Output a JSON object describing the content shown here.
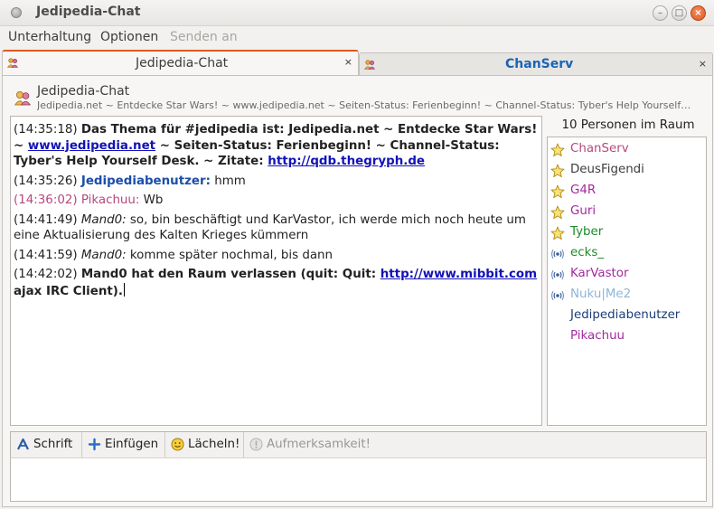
{
  "window": {
    "title": "Jedipedia-Chat"
  },
  "menu": {
    "items": [
      "Unterhaltung",
      "Optionen",
      "Senden an"
    ]
  },
  "tabs": [
    {
      "label": "Jedipedia-Chat",
      "close": "×"
    },
    {
      "label": "ChanServ",
      "close": "×"
    }
  ],
  "channel": {
    "name": "Jedipedia-Chat",
    "topic": "Jedipedia.net ~ Entdecke Star Wars! ~ www.jedipedia.net ~ Seiten-Status: Ferienbeginn! ~ Channel-Status: Tyber's Help Yourself…"
  },
  "chat": {
    "m1": {
      "time": "(14:35:18)",
      "pre": "Das Thema für #jedipedia ist: Jedipedia.net ~ Entdecke Star Wars! ~ ",
      "link1": "www.jedipedia.net",
      "mid": " ~ Seiten-Status: Ferienbeginn! ~ Channel-Status: Tyber's Help Yourself Desk. ~ Zitate: ",
      "link2": "http://qdb.thegryph.de"
    },
    "m2": {
      "time": "(14:35:26)",
      "nick": "Jedipediabenutzer:",
      "text": " hmm"
    },
    "m3": {
      "time": "(14:36:02)",
      "nick": "Pikachuu:",
      "text": " Wb"
    },
    "m4": {
      "time": "(14:41:49)",
      "nick": "Mand0:",
      "text": " so, bin beschäftigt und KarVastor, ich werde mich noch heute um eine Aktualisierung des Kalten Krieges kümmern"
    },
    "m5": {
      "time": "(14:41:59)",
      "nick": "Mand0:",
      "text": " komme später nochmal, bis dann"
    },
    "m6": {
      "time": "(14:42:02)",
      "pre": "Mand0 hat den Raum verlassen (quit: Quit: ",
      "link": "http://www.mibbit.com",
      "post": " ajax IRC Client)."
    }
  },
  "users": {
    "count_label": "10 Personen im Raum",
    "list": [
      {
        "name": "ChanServ",
        "icon": "star-icon",
        "color": "#b8477f"
      },
      {
        "name": "DeusFigendi",
        "icon": "star-icon",
        "color": "#3c3c3c"
      },
      {
        "name": "G4R",
        "icon": "star-icon",
        "color": "#a22a9e"
      },
      {
        "name": "Guri",
        "icon": "star-icon",
        "color": "#a22a9e"
      },
      {
        "name": "Tyber",
        "icon": "star-icon",
        "color": "#1d8a2a"
      },
      {
        "name": "ecks_",
        "icon": "voice-icon",
        "color": "#1d8a2a"
      },
      {
        "name": "KarVastor",
        "icon": "voice-icon",
        "color": "#a22a9e"
      },
      {
        "name": "Nuku|Me2",
        "icon": "voice-icon",
        "color": "#8fb5d8"
      },
      {
        "name": "Jedipediabenutzer",
        "icon": "",
        "color": "#1a3c78"
      },
      {
        "name": "Pikachuu",
        "icon": "",
        "color": "#a22a9e"
      }
    ]
  },
  "toolbar": {
    "font": "Schrift",
    "insert": "Einfügen",
    "smile": "Lächeln!",
    "attention": "Aufmerksamkeit!"
  }
}
